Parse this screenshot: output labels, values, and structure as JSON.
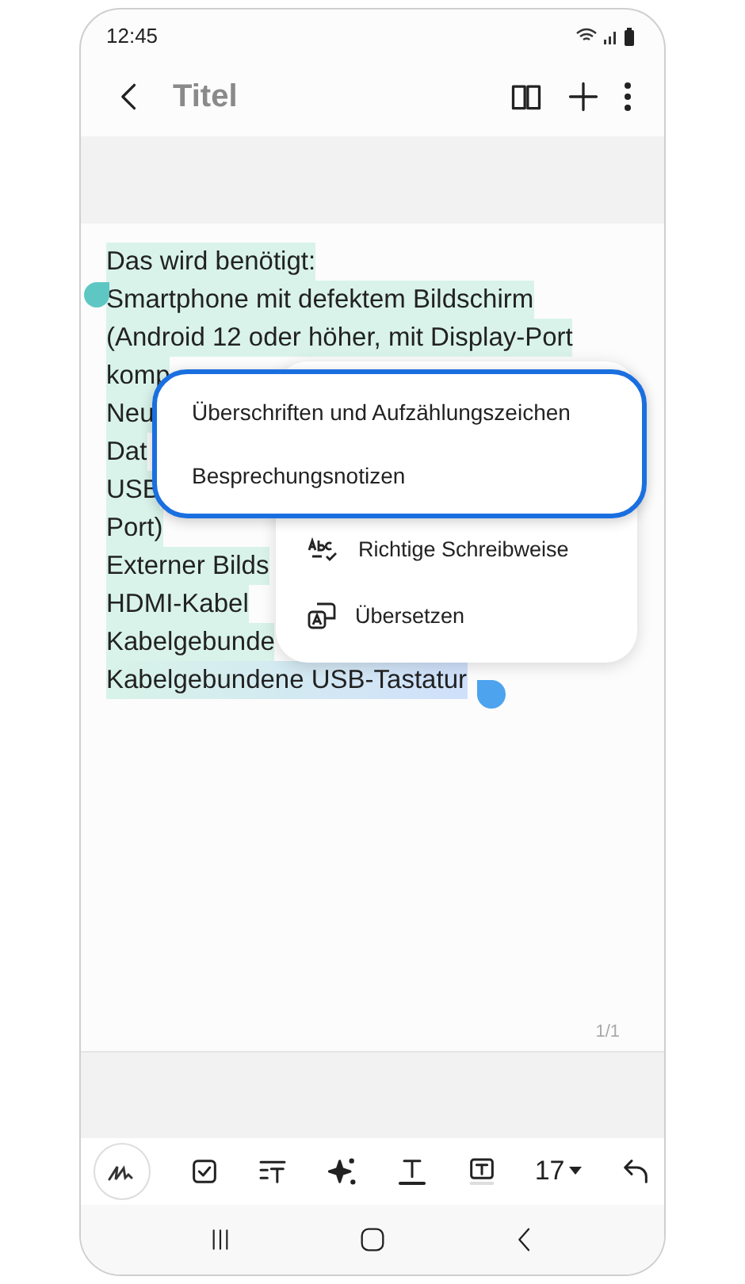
{
  "status_bar": {
    "time": "12:45"
  },
  "app_bar": {
    "title": "Titel"
  },
  "note": {
    "lines": [
      {
        "text": "Das wird benötigt:",
        "selected": true
      },
      {
        "text": "Smartphone mit defektem Bildschirm",
        "selected": true
      },
      {
        "text": "(Android 12 oder höher, mit Display-Port",
        "selected": true
      },
      {
        "text": "komp",
        "selected": true
      },
      {
        "text": "Neu",
        "selected": true
      },
      {
        "text": "Dat",
        "selected": true
      },
      {
        "text": "USB",
        "selected": true
      },
      {
        "text": "Port)",
        "selected": true
      },
      {
        "text": "Externer Bilds",
        "selected": true
      },
      {
        "text": "HDMI-Kabel",
        "selected": true
      },
      {
        "text": "Kabelgebunde",
        "selected": true
      },
      {
        "text": "Kabelgebundene USB-Tastatur",
        "selected": true
      }
    ],
    "page_counter": "1/1"
  },
  "context_menu": {
    "items": [
      {
        "label": "Richtige Schreibweise",
        "kind": "spelling"
      },
      {
        "label": "Übersetzen",
        "kind": "translate"
      }
    ]
  },
  "popup_menu": {
    "items": [
      "Überschriften und Aufzählungszeichen",
      "Besprechungsnotizen"
    ]
  },
  "toolbar": {
    "font_size": "17"
  }
}
